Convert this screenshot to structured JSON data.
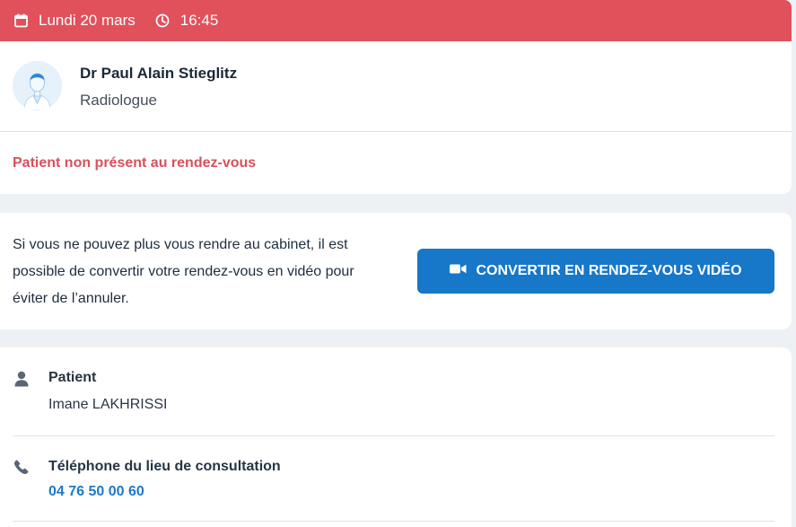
{
  "header": {
    "date": "Lundi 20 mars",
    "time": "16:45",
    "color": "#e0515c"
  },
  "doctor": {
    "name": "Dr Paul Alain Stieglitz",
    "specialty": "Radiologue"
  },
  "status": {
    "message": "Patient non présent au rendez-vous",
    "color": "#d9505b"
  },
  "video_conversion": {
    "line1": "Si vous ne pouvez plus vous rendre au cabinet, il est",
    "line2": "possible de convertir votre rendez-vous en vidéo pour",
    "line3": "éviter de l’annuler.",
    "button_label": "CONVERTIR EN RENDEZ-VOUS VIDÉO",
    "button_color": "#1777c9"
  },
  "details": {
    "patient_label": "Patient",
    "patient_name": "Imane LAKHRISSI",
    "phone_label": "Téléphone du lieu de consultation",
    "phone_number": "04 76 50 00 60"
  },
  "icons": {
    "date": "calendar-icon",
    "time": "clock-icon",
    "avatar": "doctor-avatar",
    "video": "video-camera-icon",
    "patient": "person-icon",
    "phone": "phone-icon"
  }
}
